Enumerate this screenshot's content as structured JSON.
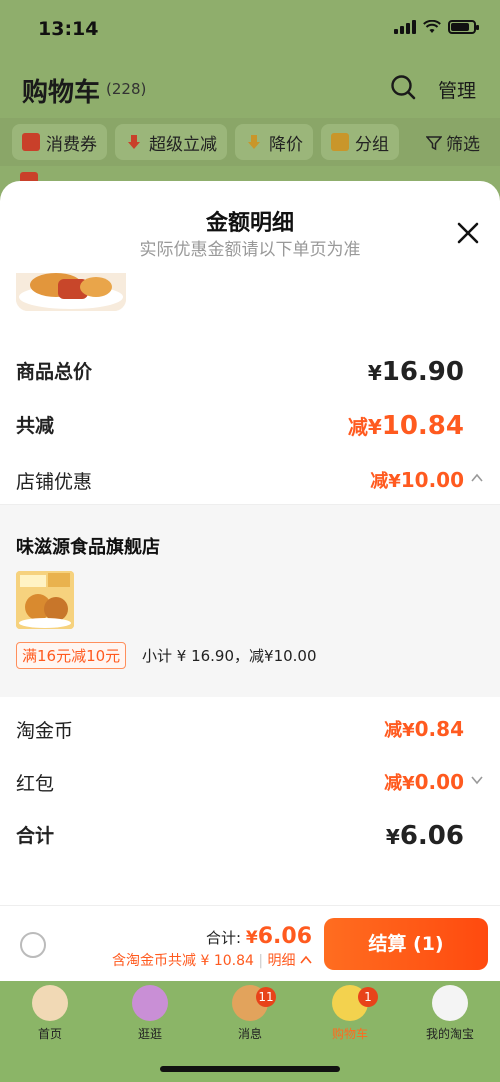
{
  "status": {
    "time": "13:14"
  },
  "cart": {
    "title": "购物车",
    "count": "(228)",
    "manage": "管理",
    "filters": [
      "消费券",
      "超级立减",
      "降价",
      "分组"
    ],
    "filter_button": "筛选"
  },
  "sheet": {
    "title": "金额明细",
    "subtitle": "实际优惠金额请以下单页为准",
    "rows": {
      "total_price": {
        "label": "商品总价",
        "yen": "¥",
        "value": "16.90"
      },
      "total_reduction": {
        "label": "共减",
        "prefix": "减",
        "yen": "¥",
        "value": "10.84"
      },
      "store_discount": {
        "label": "店铺优惠",
        "prefix": "减",
        "yen": "¥",
        "value": "10.00"
      },
      "taobao_coins": {
        "label": "淘金币",
        "prefix": "减",
        "yen": "¥",
        "value": "0.84"
      },
      "red_packet": {
        "label": "红包",
        "prefix": "减",
        "yen": "¥",
        "value": "0.00"
      },
      "sum": {
        "label": "合计",
        "yen": "¥",
        "value": "6.06"
      }
    },
    "store": {
      "name": "味滋源食品旗舰店",
      "promo_tag": "满16元减10元",
      "subtotal": "小计 ¥ 16.90，减¥10.00"
    }
  },
  "checkout": {
    "total_label": "合计:",
    "total_yen": "¥",
    "total_value": "6.06",
    "discount_text": "含淘金币共减 ¥ 10.84",
    "detail_label": "明细",
    "button_label": "结算 (1)"
  },
  "tabbar": {
    "items": [
      {
        "label": "首页",
        "badge": ""
      },
      {
        "label": "逛逛",
        "badge": ""
      },
      {
        "label": "消息",
        "badge": "11"
      },
      {
        "label": "购物车",
        "badge": "1"
      },
      {
        "label": "我的淘宝",
        "badge": ""
      }
    ]
  },
  "colors": {
    "accent": "#ff5a1f",
    "checkout_button": "#ff5a1f",
    "background_tint": "#8fae6c"
  }
}
